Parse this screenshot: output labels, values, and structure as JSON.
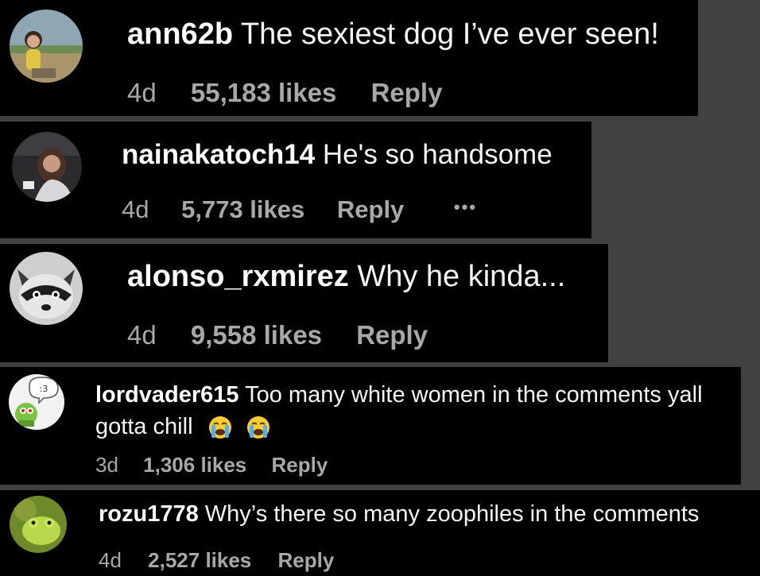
{
  "comments": [
    {
      "username": "ann62b",
      "text": "The sexiest dog I’ve ever seen!",
      "age": "4d",
      "likes": "55,183 likes",
      "reply": "Reply"
    },
    {
      "username": "nainakatoch14",
      "text": "He's so handsome",
      "age": "4d",
      "likes": "5,773 likes",
      "reply": "Reply",
      "more": "•••"
    },
    {
      "username": "alonso_rxmirez",
      "text": "Why he kinda...",
      "age": "4d",
      "likes": "9,558 likes",
      "reply": "Reply"
    },
    {
      "username": "lordvader615",
      "text": "Too many white women in the comments yall",
      "text_line2": "gotta chill",
      "age": "3d",
      "likes": "1,306 likes",
      "reply": "Reply",
      "avatar_badge": ":3"
    },
    {
      "username": "rozu1778",
      "text": "Why’s there so many zoophiles in the comments",
      "age": "4d",
      "likes": "2,527 likes",
      "reply": "Reply"
    }
  ],
  "colors": {
    "card_bg": "#000000",
    "page_bg": "#414141",
    "meta_text": "#a8a8a8",
    "primary_text": "#ffffff"
  }
}
